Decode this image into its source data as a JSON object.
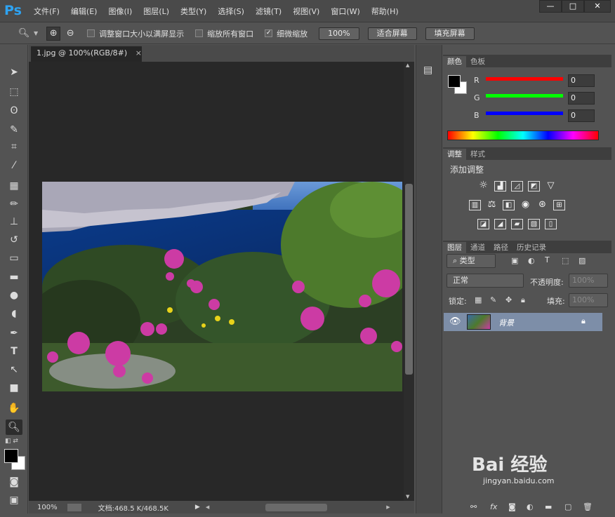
{
  "app": {
    "logo": "Ps",
    "menu": [
      "文件(F)",
      "编辑(E)",
      "图像(I)",
      "图层(L)",
      "类型(Y)",
      "选择(S)",
      "滤镜(T)",
      "视图(V)",
      "窗口(W)",
      "帮助(H)"
    ],
    "window_buttons": {
      "minimize": "—",
      "maximize": "□",
      "close": "✕"
    }
  },
  "options_bar": {
    "resize_windows": {
      "label": "调整窗口大小以满屏显示",
      "checked": false
    },
    "zoom_all": {
      "label": "缩放所有窗口",
      "checked": false
    },
    "scrubby": {
      "label": "细微缩放",
      "checked": true
    },
    "btn_100": "100%",
    "btn_fit": "适合屏幕",
    "btn_fill": "填充屏幕"
  },
  "document": {
    "tab_title": "1.jpg @ 100%(RGB/8#)",
    "tab_close": "×",
    "zoom": "100%",
    "doc_info": "文档:468.5 K/468.5K"
  },
  "color_panel": {
    "tabs": [
      "颜色",
      "色板"
    ],
    "channels": [
      {
        "label": "R",
        "value": "0",
        "color": "#ff0000"
      },
      {
        "label": "G",
        "value": "0",
        "color": "#00ff00"
      },
      {
        "label": "B",
        "value": "0",
        "color": "#0000ff"
      }
    ]
  },
  "adjust_panel": {
    "tabs": [
      "调整",
      "样式"
    ],
    "title": "添加调整"
  },
  "layers_panel": {
    "tabs": [
      "图层",
      "通道",
      "路径",
      "历史记录"
    ],
    "filter_label": "类型",
    "blend_mode": "正常",
    "opacity_label": "不透明度:",
    "opacity_value": "100%",
    "lock_label": "锁定:",
    "fill_label": "填充:",
    "fill_value": "100%",
    "layers": [
      {
        "name": "背景",
        "visible": true,
        "locked": true
      }
    ]
  },
  "watermark": {
    "text": "Bai 经验",
    "sub": "jingyan.baidu.com"
  },
  "colors": {
    "bg": "#535353",
    "canvas": "#282828",
    "selected_layer": "#7d8ea8",
    "logo": "#2ea3f2"
  }
}
